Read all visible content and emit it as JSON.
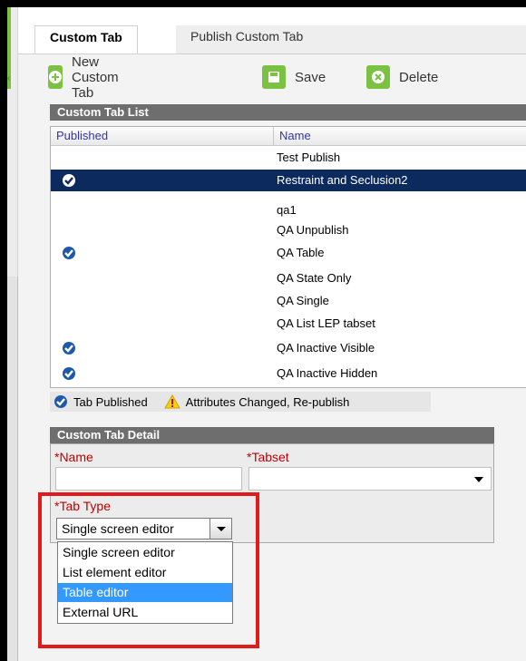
{
  "tabs": [
    {
      "label": "Custom Tab",
      "active": true
    },
    {
      "label": "Publish Custom Tab",
      "active": false
    }
  ],
  "toolbar": {
    "new_label": "New Custom Tab",
    "save_label": "Save",
    "delete_label": "Delete",
    "icon_color": "#7bc142"
  },
  "list": {
    "title": "Custom Tab List",
    "columns": [
      "Published",
      "Name"
    ],
    "rows": [
      {
        "name": "Test Publish",
        "published": false,
        "selected": false
      },
      {
        "name": "Restraint and Seclusion2",
        "published": true,
        "selected": true
      },
      {
        "name": "qa1",
        "published": false,
        "selected": false
      },
      {
        "name": "QA Unpublish",
        "published": false,
        "selected": false
      },
      {
        "name": "QA Table",
        "published": true,
        "selected": false
      },
      {
        "name": "QA State Only",
        "published": false,
        "selected": false
      },
      {
        "name": "QA Single",
        "published": false,
        "selected": false
      },
      {
        "name": "QA List LEP tabset",
        "published": false,
        "selected": false
      },
      {
        "name": "QA Inactive Visible",
        "published": true,
        "selected": false
      },
      {
        "name": "QA Inactive Hidden",
        "published": true,
        "selected": false
      }
    ],
    "selected_color": "#0c2a5e"
  },
  "legend": {
    "published_label": "Tab Published",
    "changed_label": "Attributes Changed, Re-publish"
  },
  "detail": {
    "title": "Custom Tab Detail",
    "name_label": "*Name",
    "name_value": "",
    "tabset_label": "*Tabset",
    "tabset_value": "",
    "tab_type_label": "*Tab Type",
    "tab_type_value": "Single screen editor",
    "tab_type_options": [
      {
        "label": "Single screen editor",
        "highlighted": false
      },
      {
        "label": "List element editor",
        "highlighted": false
      },
      {
        "label": "Table editor",
        "highlighted": true
      },
      {
        "label": "External URL",
        "highlighted": false
      }
    ]
  },
  "colors": {
    "required_label": "#c00000",
    "highlight": "#3399ff",
    "annotation_box": "#e11b1b"
  }
}
